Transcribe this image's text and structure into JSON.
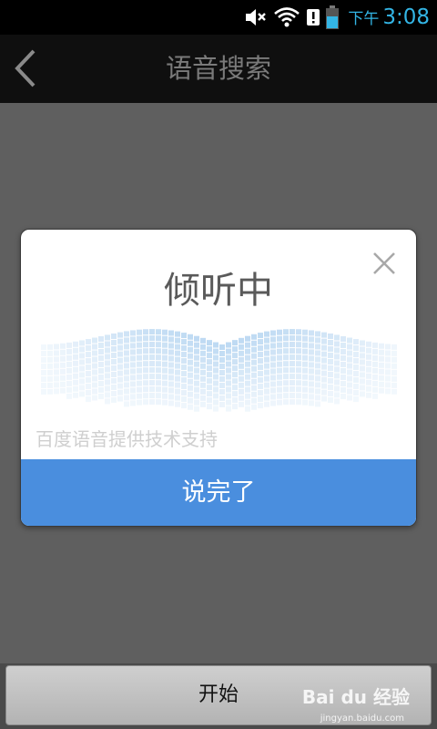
{
  "status_bar": {
    "period": "下午",
    "time": "3:08",
    "icons": [
      "volume-mute-icon",
      "wifi-icon",
      "notification-alert-icon",
      "battery-icon"
    ]
  },
  "header": {
    "title": "语音搜索",
    "back_icon": "back-chevron-icon"
  },
  "dialog": {
    "title": "倾听中",
    "close_icon": "close-icon",
    "provider_text": "百度语音提供技术支持",
    "done_label": "说完了"
  },
  "bottom": {
    "start_label": "开始"
  },
  "watermark": {
    "brand": "Bai du 经验",
    "url": "jingyan.baidu.com"
  },
  "colors": {
    "accent": "#4a8ede",
    "clock": "#33b5e5",
    "overlay": "#5f5f5f"
  }
}
